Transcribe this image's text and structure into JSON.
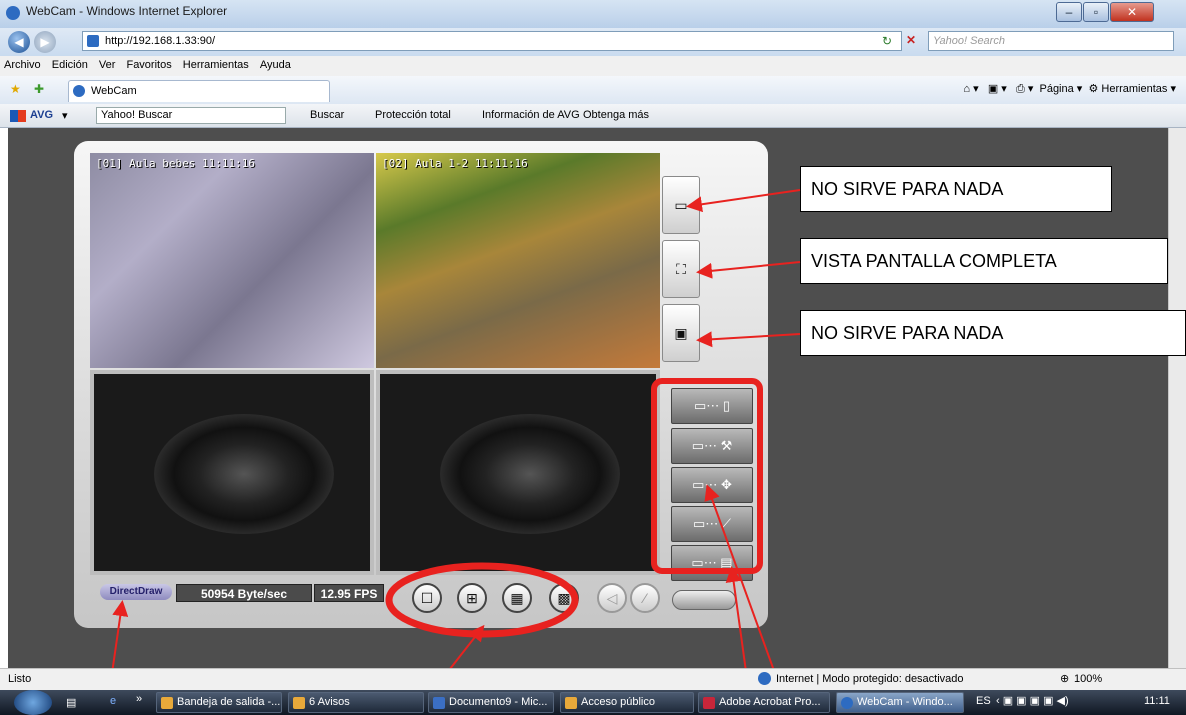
{
  "window": {
    "title": "WebCam - Windows Internet Explorer"
  },
  "address": {
    "url": "http://192.168.1.33:90/",
    "search_placeholder": "Yahoo! Search"
  },
  "menu": [
    "Archivo",
    "Edición",
    "Ver",
    "Favoritos",
    "Herramientas",
    "Ayuda"
  ],
  "tab": {
    "label": "WebCam"
  },
  "command_bar": {
    "pagina": "Página",
    "herramientas": "Herramientas"
  },
  "avg_toolbar": {
    "brand": "AVG",
    "yahoo_search": "Yahoo! Buscar",
    "buscar": "Buscar",
    "proteccion": "Protección total",
    "info": "Información de AVG",
    "obtenga": "Obtenga más"
  },
  "viewer": {
    "cam1_label": "[01] Aula bebes 11:11:16",
    "cam2_label": "[02] Aula 1-2 11:11:16",
    "renderer": "DirectDraw",
    "bitrate": "50954 Byte/sec",
    "fps": "12.95 FPS"
  },
  "annotations": {
    "a1": "NO SIRVE PARA NADA",
    "a2": "VISTA PANTALLA COMPLETA",
    "a3": "NO SIRVE PARA NADA"
  },
  "status": {
    "left": "Listo",
    "zone": "Internet | Modo protegido: desactivado",
    "zoom": "100%"
  },
  "taskbar": {
    "items": [
      "Bandeja de salida -...",
      "6 Avisos",
      "Documento9 - Mic...",
      "Acceso público",
      "Adobe Acrobat Pro...",
      "WebCam - Windo..."
    ],
    "lang": "ES",
    "clock": "11:11"
  },
  "colors": {
    "annotation_red": "#e8221f",
    "viewer_bg": "#4e4e4e"
  }
}
